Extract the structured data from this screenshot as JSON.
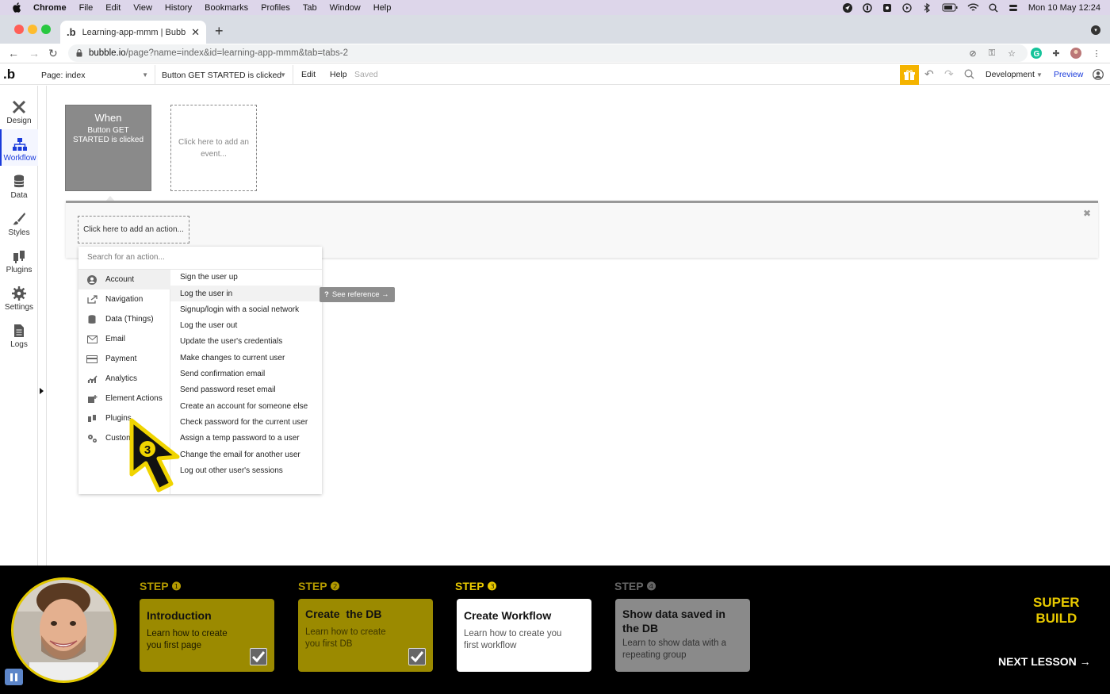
{
  "menubar": {
    "app": "Chrome",
    "items": [
      "File",
      "Edit",
      "View",
      "History",
      "Bookmarks",
      "Profiles",
      "Tab",
      "Window",
      "Help"
    ],
    "clock": "Mon 10 May  12:24"
  },
  "browser": {
    "tab_title": "Learning-app-mmm | Bubble E",
    "url_domain": "bubble.io",
    "url_path": "/page?name=index&id=learning-app-mmm&tab=tabs-2"
  },
  "toolbar": {
    "page_select": "Page: index",
    "event_select": "Button GET STARTED is clicked",
    "edit": "Edit",
    "help": "Help",
    "saved": "Saved",
    "environment": "Development",
    "preview": "Preview"
  },
  "sidebar": {
    "items": [
      {
        "label": "Design",
        "icon": "design-icon"
      },
      {
        "label": "Workflow",
        "icon": "workflow-icon"
      },
      {
        "label": "Data",
        "icon": "database-icon"
      },
      {
        "label": "Styles",
        "icon": "brush-icon"
      },
      {
        "label": "Plugins",
        "icon": "plug-icon"
      },
      {
        "label": "Settings",
        "icon": "gear-icon"
      },
      {
        "label": "Logs",
        "icon": "document-icon"
      }
    ]
  },
  "canvas": {
    "when_title": "When",
    "when_event": "Button GET STARTED is clicked",
    "add_event": "Click here to add an event...",
    "add_action": "Click here to add an action..."
  },
  "dropdown": {
    "search_placeholder": "Search for an action...",
    "categories": [
      "Account",
      "Navigation",
      "Data (Things)",
      "Email",
      "Payment",
      "Analytics",
      "Element Actions",
      "Plugins",
      "Custom"
    ],
    "actions": [
      "Sign the user up",
      "Log the user in",
      "Signup/login with a social network",
      "Log the user out",
      "Update the user's credentials",
      "Make changes to current user",
      "Send confirmation email",
      "Send password reset email",
      "Create an account for someone else",
      "Check password for the current user",
      "Assign a temp password to a user",
      "Change the email for another user",
      "Log out other user's sessions"
    ],
    "see_reference": "See reference →",
    "cursor_step": "3"
  },
  "lesson": {
    "steps": [
      {
        "label": "STEP ❶",
        "title": "Introduction",
        "sub": "Learn how to create you first page",
        "state": "done"
      },
      {
        "label": "STEP ❷",
        "title": "Create  the DB",
        "sub": "Learn how to create you first DB",
        "state": "done"
      },
      {
        "label": "STEP ❸",
        "title": "Create Workflow",
        "sub": "Learn how to create you first workflow",
        "state": "current"
      },
      {
        "label": "STEP ❹",
        "title": "Show data saved in the DB",
        "sub": "Learn to show data with a repeating group",
        "state": "upcoming"
      }
    ],
    "brand_line1": "SUPER",
    "brand_line2": "BUILD",
    "next": "NEXT LESSON →"
  },
  "colors": {
    "accent_blue": "#1a3bdb",
    "step_done": "#9b8a00",
    "step_label": "#e8c900",
    "gift": "#f5b400"
  }
}
